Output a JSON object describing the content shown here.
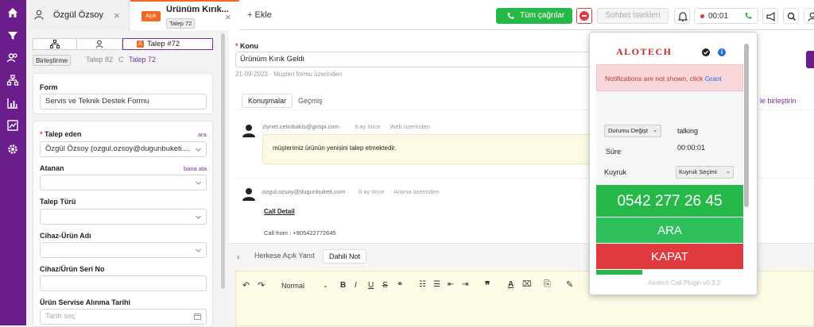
{
  "tabs": {
    "user_tab_label": "Özgül Özsoy",
    "ticket_tab_badge": "Açık",
    "ticket_tab_title": "Ürünüm Kırık...",
    "ticket_tab_sub": "Talep 72",
    "add_tab_label": "+ Ekle"
  },
  "topbar": {
    "all_calls_label": "Tüm çağrılar",
    "chat_requests_label": "Sohbet İstekleri",
    "timer": "00:01"
  },
  "left": {
    "tab_ticket_label": "Talep #72",
    "tab_ticket_badge": "A",
    "merge_label": "Birleştirme",
    "history_text": "Talep 82",
    "history_sep": "C",
    "history_current": "Talep 72",
    "form_label": "Form",
    "form_value": "Servis ve Teknik Destek Formu",
    "requester_label": "Talep eden",
    "requester_link": "ara",
    "requester_value": "Özgül Özsoy (ozgul.ozsoy@dugunbuketi....",
    "assignee_label": "Atanan",
    "assignee_link": "bana ata",
    "type_label": "Talep Türü",
    "device_label": "Cihaz-Ürün Adı",
    "serial_label": "Cihaz/Ürün Seri No",
    "date_label": "Ürün Servise Alınma Tarihi",
    "date_placeholder": "Tarih seç"
  },
  "main": {
    "subject_label": "Konu",
    "subject_value": "Ürünüm Kırık Geldi",
    "subject_meta": "21-09-2023 · Müşteri formu üzerinden",
    "tab_conversations": "Konuşmalar",
    "tab_history": "Geçmiş",
    "merge_link": "le birleştirin",
    "msg1_from": "ziynet.cetinbakis@grispi.com",
    "msg1_time": "9 ay önce",
    "msg1_via": "· Web üzerinden",
    "msg1_body": "müşterimiz ürünün yenisini talep etmektedir.",
    "msg2_from": "ozgul.ozsoy@dugunbuketi.com",
    "msg2_time": "9 ay önce",
    "msg2_via": "· Arama üzerinden",
    "msg2_detail": "Call Detail",
    "msg2_call_from": "Call from :  +905422772645",
    "reply_public": "Herkese Açık Yanıt",
    "reply_internal": "Dahili Not",
    "format_select": "Normal"
  },
  "popup": {
    "brand": "ALOTECH",
    "notice": "Notifications are not shown, click",
    "notice_link": "Grant",
    "status_select": "Durumu Değişt",
    "status_value": "talking",
    "duration_label": "Süre",
    "duration_value": "00:00:01",
    "queue_label": "Kuyruk",
    "queue_select": "Kuyruk Seçimi",
    "phone_number": "0542 277 26 45",
    "call_button": "ARA",
    "hangup_button": "KAPAT",
    "version": "Alotech Call Plugin v0.3.2"
  },
  "colors": {
    "sidebar": "#6b1d8c",
    "accent_orange": "#f26a21",
    "green": "#27b84a",
    "red": "#e0393e",
    "purple_link": "#7b2d9b"
  }
}
